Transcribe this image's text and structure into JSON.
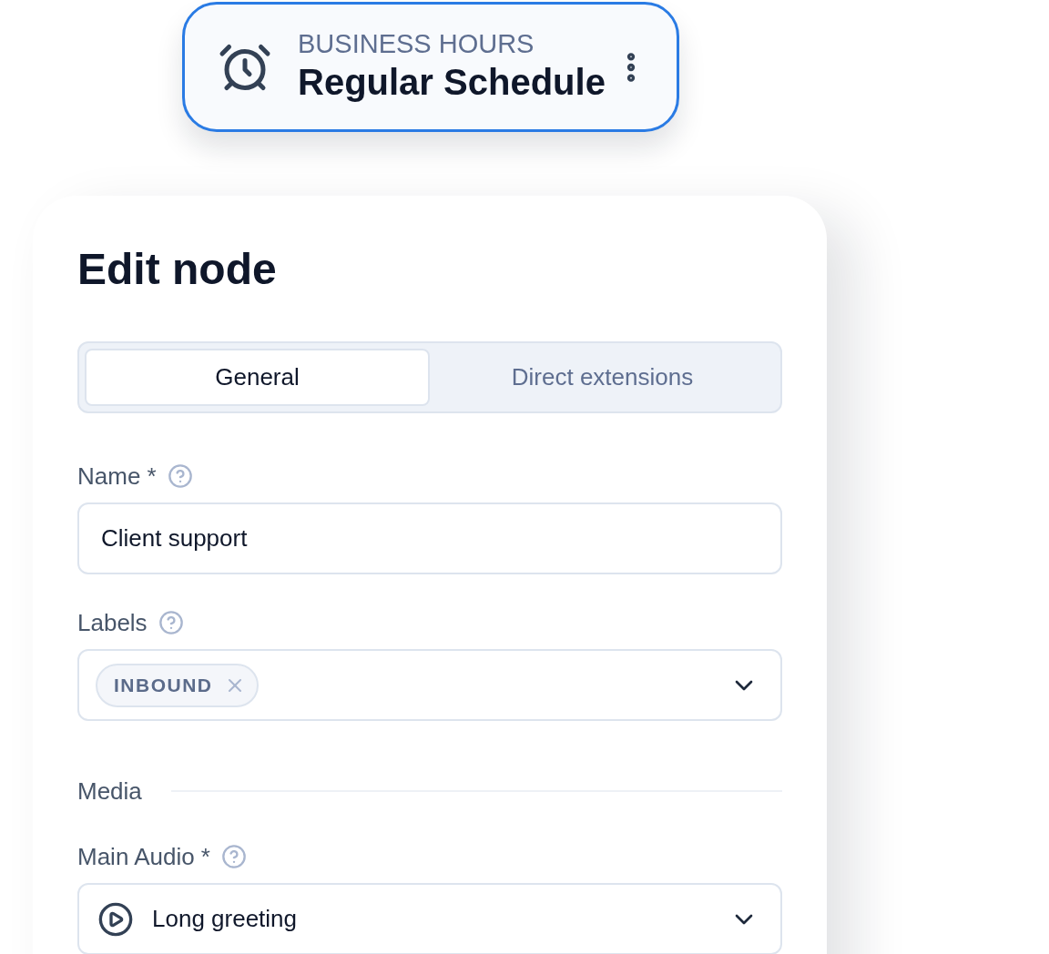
{
  "node_card": {
    "category": "BUSINESS HOURS",
    "title": "Regular Schedule"
  },
  "panel": {
    "title": "Edit node",
    "tabs": [
      {
        "label": "General",
        "selected": true
      },
      {
        "label": "Direct extensions",
        "selected": false
      }
    ],
    "fields": [
      {
        "kind": "text",
        "label": "Name *",
        "help": true,
        "value": "Client support"
      },
      {
        "kind": "tags",
        "label": "Labels",
        "help": true,
        "tags": [
          "INBOUND"
        ]
      },
      {
        "kind": "section",
        "label": "Media"
      },
      {
        "kind": "audio",
        "label": "Main Audio *",
        "help": true,
        "value": "Long greeting"
      }
    ]
  }
}
